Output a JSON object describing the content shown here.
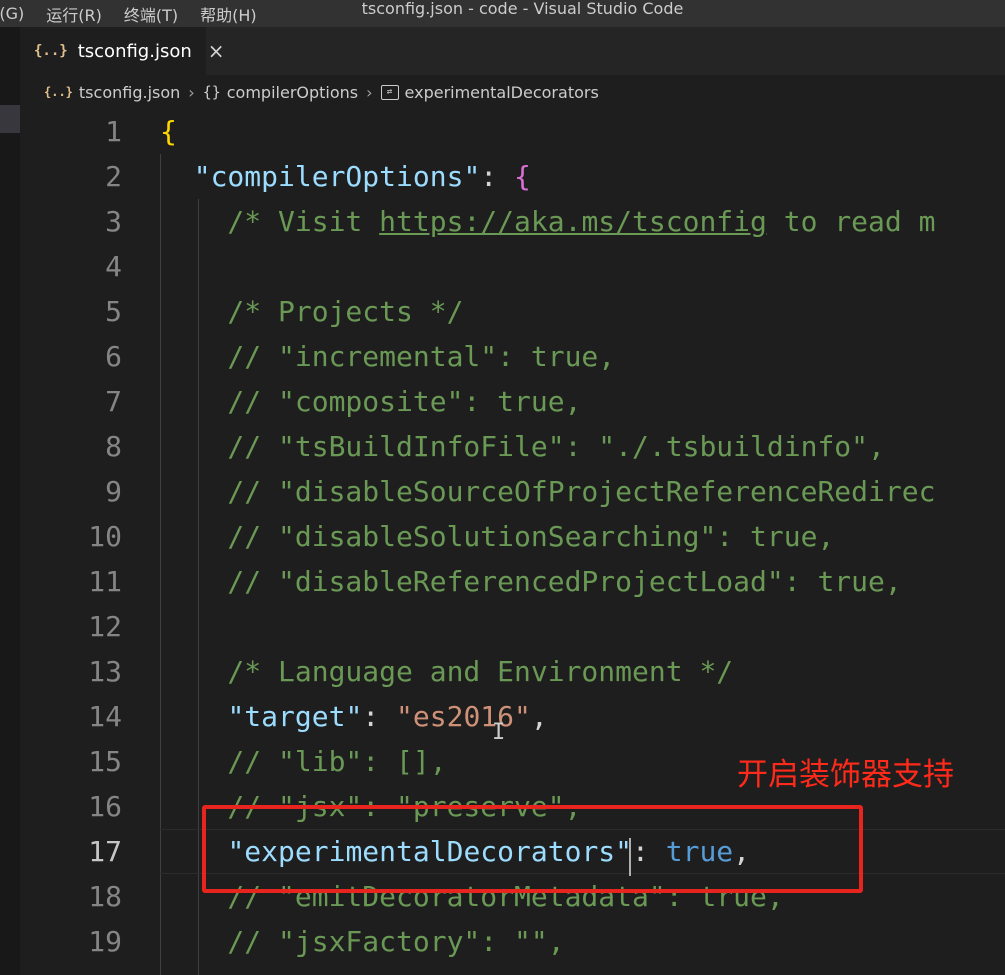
{
  "titlebar": {
    "menus": [
      "|(G)",
      "运行(R)",
      "终端(T)",
      "帮助(H)"
    ],
    "title": "tsconfig.json - code - Visual Studio Code"
  },
  "tab": {
    "icon": "{..}",
    "label": "tsconfig.json",
    "close": "×"
  },
  "breadcrumb": {
    "file": "tsconfig.json",
    "obj_icon": "{}",
    "obj": "compilerOptions",
    "prop": "experimentalDecorators"
  },
  "annotation": {
    "text": "开启装饰器支持"
  },
  "editor": {
    "active_line": 17,
    "lines": [
      {
        "n": "1",
        "tokens": [
          {
            "t": "{",
            "c": "br1"
          }
        ]
      },
      {
        "n": "2",
        "tokens": [
          {
            "t": "  ",
            "c": "p"
          },
          {
            "t": "\"compilerOptions\"",
            "c": "key"
          },
          {
            "t": ": ",
            "c": "p"
          },
          {
            "t": "{",
            "c": "br2"
          }
        ]
      },
      {
        "n": "3",
        "tokens": [
          {
            "t": "    /* Visit ",
            "c": "cm"
          },
          {
            "t": "https://aka.ms/tsconfig",
            "c": "cm link"
          },
          {
            "t": " to read m",
            "c": "cm"
          }
        ]
      },
      {
        "n": "4",
        "tokens": []
      },
      {
        "n": "5",
        "tokens": [
          {
            "t": "    /* Projects */",
            "c": "cm"
          }
        ]
      },
      {
        "n": "6",
        "tokens": [
          {
            "t": "    // \"incremental\": true,",
            "c": "cm"
          }
        ]
      },
      {
        "n": "7",
        "tokens": [
          {
            "t": "    // \"composite\": true,",
            "c": "cm"
          }
        ]
      },
      {
        "n": "8",
        "tokens": [
          {
            "t": "    // \"tsBuildInfoFile\": \"./.tsbuildinfo\",",
            "c": "cm"
          }
        ]
      },
      {
        "n": "9",
        "tokens": [
          {
            "t": "    // \"disableSourceOfProjectReferenceRedirec",
            "c": "cm"
          }
        ]
      },
      {
        "n": "10",
        "tokens": [
          {
            "t": "    // \"disableSolutionSearching\": true,",
            "c": "cm"
          }
        ]
      },
      {
        "n": "11",
        "tokens": [
          {
            "t": "    // \"disableReferencedProjectLoad\": true,",
            "c": "cm"
          }
        ]
      },
      {
        "n": "12",
        "tokens": []
      },
      {
        "n": "13",
        "tokens": [
          {
            "t": "    /* Language and Environment */",
            "c": "cm"
          }
        ]
      },
      {
        "n": "14",
        "tokens": [
          {
            "t": "    ",
            "c": "p"
          },
          {
            "t": "\"target\"",
            "c": "key"
          },
          {
            "t": ": ",
            "c": "p"
          },
          {
            "t": "\"es2016\"",
            "c": "str"
          },
          {
            "t": ",",
            "c": "p"
          }
        ]
      },
      {
        "n": "15",
        "tokens": [
          {
            "t": "    // \"lib\": [],",
            "c": "cm"
          }
        ]
      },
      {
        "n": "16",
        "tokens": [
          {
            "t": "    // \"jsx\": \"preserve\",",
            "c": "cm"
          }
        ]
      },
      {
        "n": "17",
        "tokens": [
          {
            "t": "    ",
            "c": "p"
          },
          {
            "t": "\"experimentalDecorators\"",
            "c": "key"
          },
          {
            "t": ": ",
            "c": "p"
          },
          {
            "t": "true",
            "c": "bool"
          },
          {
            "t": ",",
            "c": "p"
          }
        ]
      },
      {
        "n": "18",
        "tokens": [
          {
            "t": "    // \"emitDecoratorMetadata\": true,",
            "c": "cm"
          }
        ]
      },
      {
        "n": "19",
        "tokens": [
          {
            "t": "    // \"jsxFactory\": \"\",",
            "c": "cm"
          }
        ]
      }
    ]
  }
}
